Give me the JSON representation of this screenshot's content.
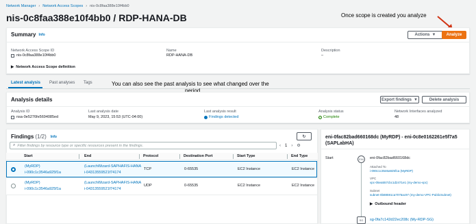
{
  "breadcrumb": {
    "items": [
      "Network Manager",
      "Network Access Scopes",
      "nis-0c8faa388e10f4bb0"
    ]
  },
  "page_title": "nis-0c8faa388e10f4bb0 / RDP-HANA-DB",
  "annotations": {
    "analyze_note": "Once scope is created you analyze",
    "past_analysis_note_line1": "You can also see the past analysis to see what changed over the",
    "past_analysis_note_line2": "period"
  },
  "summary": {
    "heading": "Summary",
    "info": "Info",
    "actions_label": "Actions",
    "analyze_label": "Analyze",
    "scope_id_label": "Network Access Scope ID",
    "scope_id_value": "nis-0c8faa388e10f4bb0",
    "name_label": "Name",
    "name_value": "RDP-HANA-DB",
    "description_label": "Description",
    "description_value": "–",
    "definition_label": "Network Access Scope definition"
  },
  "tabs": [
    "Latest analysis",
    "Past analyses",
    "Tags"
  ],
  "analysis": {
    "heading": "Analysis details",
    "export_label": "Export findings",
    "delete_label": "Delete analysis",
    "id_label": "Analysis ID",
    "id_value": "nsa-0e5276fe5694085ed",
    "last_date_label": "Last analysis date",
    "last_date_value": "May 9, 2023, 15:53 (UTC-04:00)",
    "last_result_label": "Last analysis result",
    "last_result_value": "Findings detected",
    "status_label": "Analysis status",
    "status_value": "Complete",
    "interfaces_label": "Network Interfaces analyzed",
    "interfaces_value": "48"
  },
  "findings": {
    "heading": "Findings",
    "count": "(1/2)",
    "info": "Info",
    "filter_placeholder": "Filter findings by resource type or specific resources present in the findings.",
    "page_number": "1",
    "columns": [
      "Start",
      "End",
      "Protocol",
      "Destination Port",
      "Start Type",
      "End Type"
    ],
    "rows": [
      {
        "start_name": "(MyRDP)",
        "start_id": "i-090c1c3546a925f1a",
        "end_name": "(LaunchWizard-SAPHAFIS-HANA",
        "end_id": "i-04313559521f74174",
        "protocol": "TCP",
        "port": "0-65535",
        "start_type": "EC2 Instance",
        "end_type": "EC2 Instance",
        "selected": true
      },
      {
        "start_name": "(MyRDP)",
        "start_id": "i-090c1c3546a925f1a",
        "end_name": "(LaunchWizard-SAPHAFIS-HANA",
        "end_id": "i-04313559521f74174",
        "protocol": "UDP",
        "port": "0-65535",
        "start_type": "EC2 Instance",
        "end_type": "EC2 Instance",
        "selected": false
      }
    ]
  },
  "detail": {
    "title_line1": "eni-0fac82bad660168dc (MyRDP) - eni-0c8e0162261e5f7a5",
    "title_line2": "(SAPLabHA)",
    "start_label": "Start",
    "eni_value": "eni-0fac82bad660168dc",
    "attached_label": "Attached To",
    "attached_value": "i-090c1c3546a925f1a (MyRDP)",
    "vpc_label": "VPC",
    "vpc_value": "vpc-05ea557cbc1d2471e1 (my-demo-vpc)",
    "subnet_label": "Subnet",
    "subnet_value": "subnet-0b88591ca7075ac97 (my-demo-VPC-PublicSubnet)",
    "outbound_label": "Outbound header",
    "sg_value": "sg-0fa7c142d22ec208c (My-RDP-SG)",
    "eni_badge": "ENI",
    "sg_badge": "SG"
  }
}
